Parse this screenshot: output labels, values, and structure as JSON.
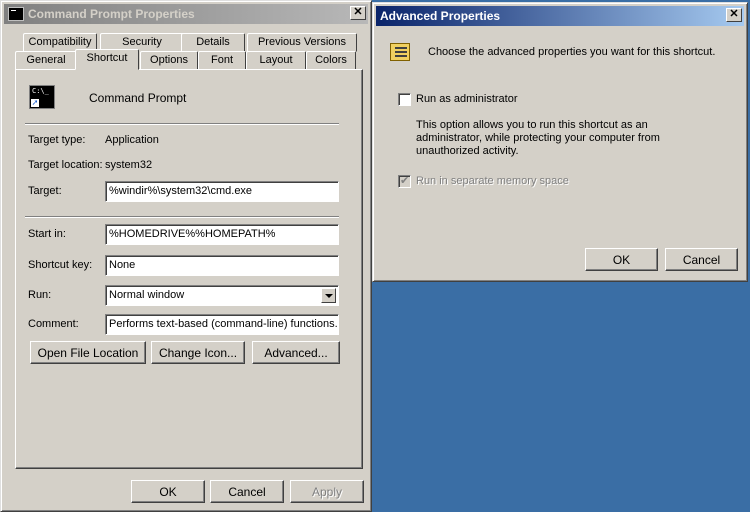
{
  "properties_window": {
    "title": "Command Prompt Properties",
    "close_glyph": "✕",
    "tabs_row1": [
      "Compatibility",
      "Security",
      "Details",
      "Previous Versions"
    ],
    "tabs_row2": [
      "General",
      "Shortcut",
      "Options",
      "Font",
      "Layout",
      "Colors"
    ],
    "active_tab": "Shortcut",
    "shortcut_name": "Command Prompt",
    "icon_text": "C:\\_",
    "fields": {
      "target_type_label": "Target type:",
      "target_type_value": "Application",
      "target_location_label": "Target location:",
      "target_location_value": "system32",
      "target_label": "Target:",
      "target_value": "%windir%\\system32\\cmd.exe",
      "start_in_label": "Start in:",
      "start_in_value": "%HOMEDRIVE%%HOMEPATH%",
      "shortcut_key_label": "Shortcut key:",
      "shortcut_key_value": "None",
      "run_label": "Run:",
      "run_value": "Normal window",
      "comment_label": "Comment:",
      "comment_value": "Performs text-based (command-line) functions."
    },
    "buttons": {
      "open_file_location": "Open File Location",
      "change_icon": "Change Icon...",
      "advanced": "Advanced...",
      "ok": "OK",
      "cancel": "Cancel",
      "apply": "Apply"
    }
  },
  "advanced_window": {
    "title": "Advanced Properties",
    "close_glyph": "✕",
    "intro": "Choose the advanced properties you want for this shortcut.",
    "run_as_admin_label": "Run as administrator",
    "run_as_admin_description": "This option allows you to run this shortcut as an administrator, while protecting your computer from unauthorized activity.",
    "separate_memory_label": "Run in separate memory space",
    "separate_memory_checked": true,
    "ok": "OK",
    "cancel": "Cancel"
  }
}
